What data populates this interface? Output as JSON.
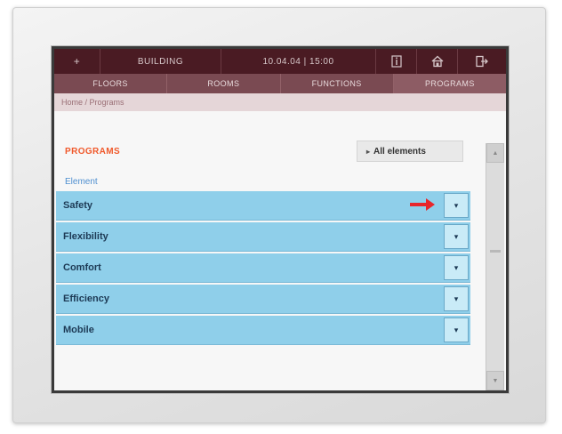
{
  "topbar": {
    "menu_icon": "plus-icon",
    "menu_glyph": "+",
    "title": "BUILDING",
    "datetime": "10.04.04 | 15:00",
    "icons": [
      "info-icon",
      "home-icon",
      "logout-icon"
    ]
  },
  "tabs": [
    {
      "label": "FLOORS"
    },
    {
      "label": "ROOMS"
    },
    {
      "label": "FUNCTIONS"
    },
    {
      "label": "PROGRAMS"
    }
  ],
  "breadcrumb": "Home / Programs",
  "content": {
    "section_title": "PROGRAMS",
    "filter": {
      "label": "All elements",
      "icon": "triangle-right-icon",
      "glyph": "▸"
    },
    "column_header": "Element",
    "rows": [
      {
        "label": "Safety"
      },
      {
        "label": "Flexibility"
      },
      {
        "label": "Comfort"
      },
      {
        "label": "Efficiency"
      },
      {
        "label": "Mobile"
      }
    ],
    "row_action_glyph": "▾",
    "scroll": {
      "up_glyph": "▲",
      "down_glyph": "▼"
    }
  },
  "colors": {
    "topbar": "#4a1b23",
    "tabs": "#7a4a52",
    "row": "#8fcfea",
    "accent": "#f0592b",
    "arrow": "#e8262b"
  }
}
